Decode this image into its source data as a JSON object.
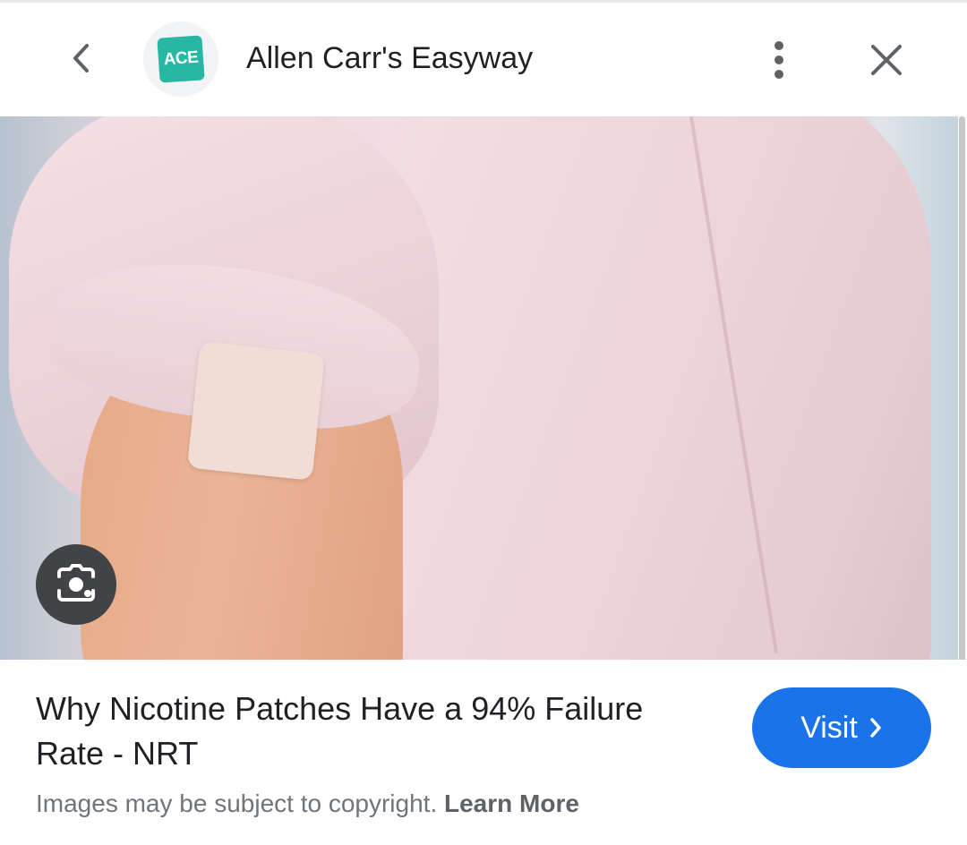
{
  "header": {
    "back_icon": "chevron-left-icon",
    "logo_text": "ACE",
    "site_name": "Allen Carr's Easyway",
    "more_icon": "more-vert-icon",
    "close_icon": "close-icon"
  },
  "image": {
    "lens_icon": "lens-search-icon"
  },
  "result": {
    "title": "Why Nicotine Patches Have a 94% Failure Rate - NRT",
    "visit_label": "Visit",
    "visit_icon": "chevron-right-icon",
    "disclaimer": "Images may be subject to copyright.",
    "learn_more": "Learn More"
  },
  "colors": {
    "accent": "#1a73e8",
    "logo_bg": "#27b7a3",
    "lens_button": "#414346"
  }
}
